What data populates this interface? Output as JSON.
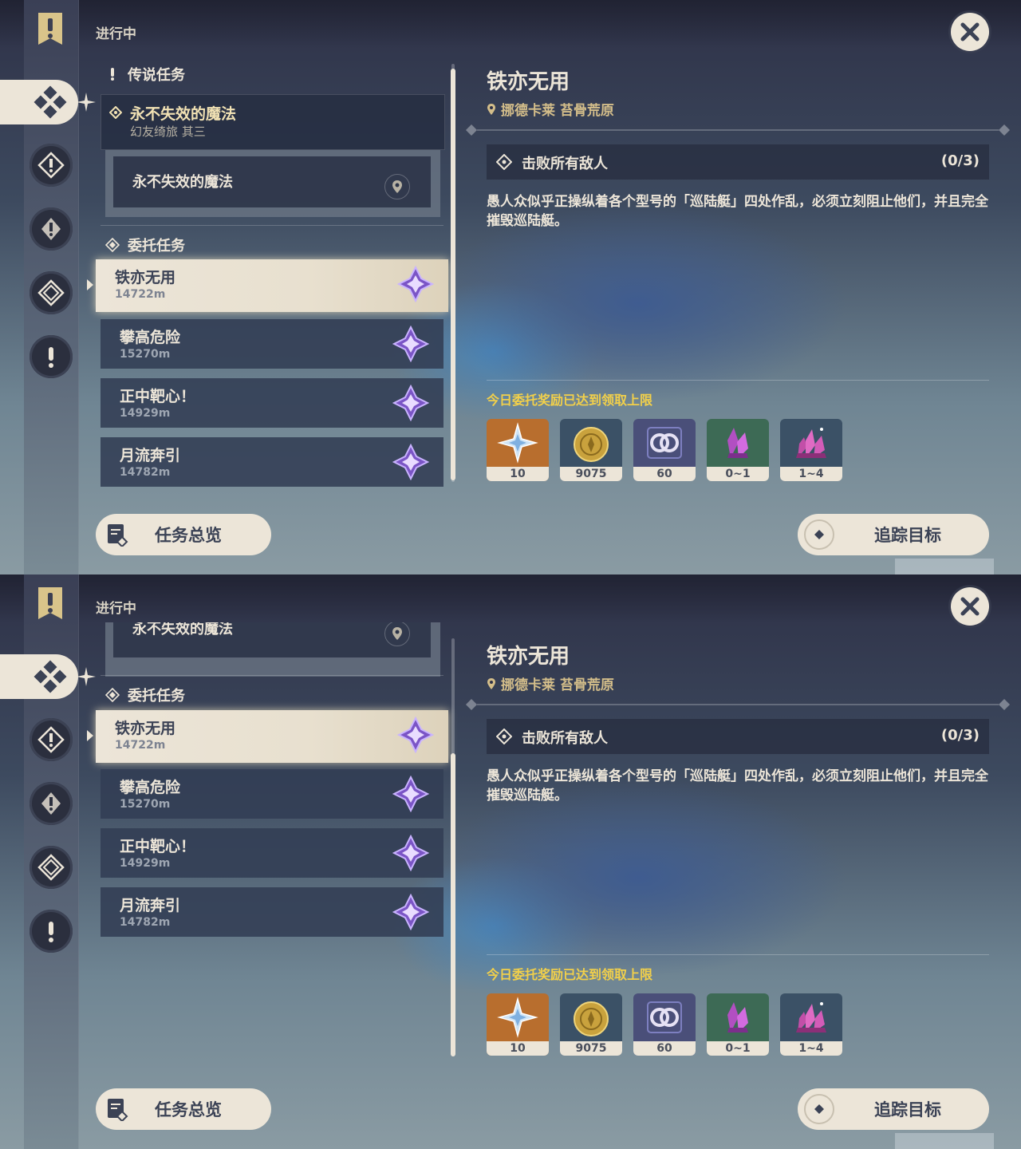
{
  "header": {
    "status_label": "进行中"
  },
  "legend_section": {
    "title": "传说任务",
    "quest_name": "永不失效的魔法",
    "quest_chapter": "幻友绮旅 其三",
    "sub_quest": "永不失效的魔法"
  },
  "commission_section": {
    "title": "委托任务",
    "tasks": [
      {
        "name": "铁亦无用",
        "distance": "14722m"
      },
      {
        "name": "攀高危险",
        "distance": "15270m"
      },
      {
        "name": "正中靶心！",
        "distance": "14929m"
      },
      {
        "name": "月流奔引",
        "distance": "14782m"
      }
    ]
  },
  "detail": {
    "title": "铁亦无用",
    "location": "挪德卡莱 苔骨荒原",
    "objective": "击败所有敌人",
    "objective_count": "(0/3)",
    "description": "愚人众似乎正操纵着各个型号的「巡陆艇」四处作乱，必须立刻阻止他们，并且完全摧毁巡陆艇。",
    "reward_notice": "今日委托奖励已达到领取上限",
    "rewards": [
      {
        "icon": "primogem-icon",
        "count": "10",
        "bg": "#b86e2e"
      },
      {
        "icon": "mora-icon",
        "count": "9075",
        "bg": "#3b5166"
      },
      {
        "icon": "companionship-exp-icon",
        "count": "60",
        "bg": "#4a4f79"
      },
      {
        "icon": "crystal-icon",
        "count": "0~1",
        "bg": "#3d6a55"
      },
      {
        "icon": "crystal-cluster-icon",
        "count": "1~4",
        "bg": "#3b5166"
      }
    ]
  },
  "buttons": {
    "overview": "任务总览",
    "track": "追踪目标"
  },
  "colors": {
    "accent": "#ece5d8",
    "gold_text": "#d4be8a",
    "notice_yellow": "#f2d04a",
    "commission_purple": "#9b6fe0"
  }
}
